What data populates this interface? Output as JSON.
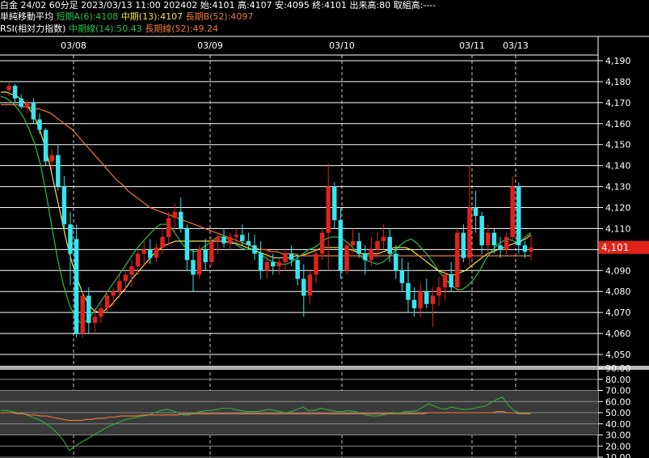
{
  "header": {
    "line1": "白金 24/02 60分足 2023/03/13 11:00 202402 始:4101 高:4107 安:4095 終:4101 出来高:80 取組高:----",
    "line2_title": "単純移動平均",
    "line2_short": "短期A(6):4108",
    "line2_mid": "中期(13):4107",
    "line2_long": "長期B(52):4097",
    "line3_title": "RSI(相対力指数)",
    "line3_mid": "中期線(14):50.43",
    "line3_long": "長期線(52):49.24"
  },
  "colors": {
    "up": "#e0221b",
    "down": "#36e6f2",
    "sma_short": "#26c24a",
    "sma_mid": "#f2e34a",
    "sma_long": "#f07a3a",
    "rsi_mid": "#2fae3a",
    "rsi_long": "#f07a3a",
    "price_tag": "#e0221b"
  },
  "chart_data": [
    {
      "type": "candlestick",
      "x_labels": [
        "03/08",
        "03/09",
        "03/10",
        "03/11",
        "03/13"
      ],
      "y_ticks": [
        "4,050",
        "4,060",
        "4,070",
        "4,080",
        "4,090",
        "4,100",
        "4,110",
        "4,120",
        "4,130",
        "4,140",
        "4,150",
        "4,160",
        "4,170",
        "4,180",
        "4,190"
      ],
      "ylim": [
        4045,
        4195
      ],
      "last_price_label": "4,101",
      "last_price": 4101,
      "series": [
        {
          "name": "短期A(6)",
          "values": [
            4173,
            4172,
            4170,
            4167,
            4163,
            4157,
            4150,
            4140,
            4126,
            4110,
            4095,
            4083,
            4074,
            4068,
            4065,
            4066,
            4069,
            4073,
            4077,
            4081,
            4085,
            4089,
            4093,
            4097,
            4101,
            4104,
            4107,
            4110,
            4112,
            4112,
            4110,
            4106,
            4102,
            4100,
            4099,
            4100,
            4102,
            4104,
            4106,
            4106,
            4105,
            4103,
            4101,
            4100,
            4100,
            4099,
            4097,
            4095,
            4094,
            4093,
            4093,
            4094,
            4096,
            4098,
            4100,
            4101,
            4103,
            4105,
            4106,
            4106,
            4105,
            4103,
            4100,
            4097,
            4095,
            4094,
            4093,
            4094,
            4096,
            4099,
            4102,
            4104,
            4105,
            4103,
            4100,
            4097,
            4093,
            4089,
            4086,
            4083,
            4081,
            4081,
            4083,
            4086,
            4090,
            4095,
            4099,
            4102,
            4104,
            4105,
            4104,
            4103,
            4106,
            4108
          ]
        },
        {
          "name": "中期(13)",
          "values": [
            4175,
            4175,
            4174,
            4173,
            4171,
            4168,
            4164,
            4158,
            4150,
            4140,
            4128,
            4116,
            4104,
            4094,
            4086,
            4079,
            4074,
            4071,
            4070,
            4071,
            4073,
            4076,
            4079,
            4082,
            4086,
            4089,
            4092,
            4095,
            4098,
            4100,
            4102,
            4103,
            4104,
            4104,
            4104,
            4104,
            4104,
            4104,
            4104,
            4104,
            4104,
            4104,
            4103,
            4103,
            4102,
            4101,
            4100,
            4099,
            4098,
            4097,
            4096,
            4096,
            4096,
            4096,
            4097,
            4097,
            4098,
            4099,
            4100,
            4101,
            4101,
            4101,
            4101,
            4100,
            4100,
            4099,
            4098,
            4098,
            4098,
            4098,
            4099,
            4100,
            4101,
            4101,
            4101,
            4100,
            4098,
            4096,
            4094,
            4092,
            4090,
            4089,
            4088,
            4088,
            4089,
            4090,
            4092,
            4094,
            4096,
            4098,
            4099,
            4100,
            4101,
            4102,
            4103,
            4104,
            4105,
            4107
          ]
        },
        {
          "name": "長期B(52)",
          "values": [
            4169,
            4169,
            4169,
            4169,
            4168,
            4168,
            4167,
            4167,
            4166,
            4165,
            4163,
            4161,
            4159,
            4157,
            4154,
            4151,
            4148,
            4145,
            4142,
            4139,
            4136,
            4133,
            4131,
            4128,
            4126,
            4124,
            4122,
            4120,
            4119,
            4118,
            4117,
            4116,
            4115,
            4114,
            4113,
            4112,
            4111,
            4110,
            4109,
            4108,
            4107,
            4106,
            4105,
            4104,
            4103,
            4102,
            4101,
            4100,
            4100,
            4099,
            4099,
            4098,
            4098,
            4098,
            4097,
            4097,
            4097,
            4097,
            4097,
            4097,
            4097,
            4097,
            4097,
            4097,
            4097,
            4097,
            4097,
            4097,
            4097,
            4097,
            4097,
            4097,
            4097,
            4097,
            4097,
            4097,
            4097,
            4097,
            4097,
            4097,
            4097,
            4097,
            4097,
            4097,
            4097,
            4097,
            4097,
            4097,
            4097,
            4097,
            4097,
            4097,
            4097,
            4097,
            4097,
            4097,
            4097
          ]
        }
      ],
      "candles": [
        [
          4176,
          4180,
          4173,
          4178
        ],
        [
          4178,
          4179,
          4170,
          4172
        ],
        [
          4172,
          4174,
          4167,
          4168
        ],
        [
          4168,
          4171,
          4165,
          4170
        ],
        [
          4170,
          4172,
          4160,
          4162
        ],
        [
          4162,
          4165,
          4155,
          4157
        ],
        [
          4157,
          4158,
          4140,
          4142
        ],
        [
          4142,
          4148,
          4138,
          4145
        ],
        [
          4145,
          4150,
          4128,
          4130
        ],
        [
          4130,
          4135,
          4110,
          4112
        ],
        [
          4112,
          4118,
          4083,
          4098
        ],
        [
          4105,
          4112,
          4058,
          4060
        ],
        [
          4060,
          4080,
          4058,
          4078
        ],
        [
          4078,
          4082,
          4060,
          4065
        ],
        [
          4065,
          4072,
          4060,
          4068
        ],
        [
          4068,
          4075,
          4065,
          4072
        ],
        [
          4072,
          4080,
          4070,
          4078
        ],
        [
          4078,
          4082,
          4073,
          4080
        ],
        [
          4080,
          4088,
          4077,
          4085
        ],
        [
          4085,
          4090,
          4080,
          4088
        ],
        [
          4088,
          4095,
          4082,
          4092
        ],
        [
          4092,
          4100,
          4088,
          4098
        ],
        [
          4098,
          4105,
          4092,
          4100
        ],
        [
          4100,
          4105,
          4093,
          4096
        ],
        [
          4096,
          4103,
          4094,
          4101
        ],
        [
          4101,
          4110,
          4098,
          4106
        ],
        [
          4106,
          4118,
          4102,
          4115
        ],
        [
          4115,
          4122,
          4108,
          4118
        ],
        [
          4118,
          4125,
          4108,
          4110
        ],
        [
          4110,
          4112,
          4090,
          4095
        ],
        [
          4095,
          4100,
          4080,
          4088
        ],
        [
          4088,
          4102,
          4086,
          4100
        ],
        [
          4100,
          4105,
          4090,
          4094
        ],
        [
          4094,
          4106,
          4092,
          4104
        ],
        [
          4104,
          4108,
          4098,
          4106
        ],
        [
          4106,
          4110,
          4101,
          4103
        ],
        [
          4103,
          4108,
          4100,
          4106
        ],
        [
          4106,
          4110,
          4103,
          4107
        ],
        [
          4107,
          4112,
          4102,
          4104
        ],
        [
          4104,
          4108,
          4100,
          4102
        ],
        [
          4102,
          4107,
          4095,
          4098
        ],
        [
          4098,
          4104,
          4086,
          4090
        ],
        [
          4090,
          4100,
          4086,
          4094
        ],
        [
          4094,
          4098,
          4088,
          4092
        ],
        [
          4092,
          4096,
          4088,
          4094
        ],
        [
          4094,
          4100,
          4090,
          4098
        ],
        [
          4098,
          4102,
          4092,
          4095
        ],
        [
          4095,
          4098,
          4083,
          4086
        ],
        [
          4086,
          4093,
          4068,
          4078
        ],
        [
          4078,
          4090,
          4074,
          4088
        ],
        [
          4088,
          4100,
          4084,
          4098
        ],
        [
          4098,
          4110,
          4095,
          4108
        ],
        [
          4108,
          4141,
          4090,
          4130
        ],
        [
          4130,
          4132,
          4110,
          4114
        ],
        [
          4114,
          4120,
          4086,
          4090
        ],
        [
          4090,
          4104,
          4088,
          4102
        ],
        [
          4102,
          4110,
          4098,
          4104
        ],
        [
          4104,
          4108,
          4096,
          4098
        ],
        [
          4098,
          4102,
          4088,
          4095
        ],
        [
          4095,
          4106,
          4092,
          4100
        ],
        [
          4100,
          4108,
          4096,
          4104
        ],
        [
          4104,
          4112,
          4100,
          4106
        ],
        [
          4106,
          4110,
          4094,
          4098
        ],
        [
          4098,
          4102,
          4086,
          4090
        ],
        [
          4090,
          4096,
          4080,
          4084
        ],
        [
          4084,
          4094,
          4070,
          4076
        ],
        [
          4076,
          4082,
          4068,
          4072
        ],
        [
          4072,
          4084,
          4068,
          4080
        ],
        [
          4080,
          4086,
          4072,
          4074
        ],
        [
          4074,
          4082,
          4063,
          4078
        ],
        [
          4078,
          4087,
          4073,
          4082
        ],
        [
          4082,
          4090,
          4076,
          4088
        ],
        [
          4088,
          4094,
          4080,
          4082
        ],
        [
          4082,
          4110,
          4080,
          4108
        ],
        [
          4108,
          4112,
          4094,
          4096
        ],
        [
          4096,
          4140,
          4092,
          4120
        ],
        [
          4120,
          4128,
          4108,
          4116
        ],
        [
          4116,
          4118,
          4098,
          4102
        ],
        [
          4102,
          4112,
          4098,
          4108
        ],
        [
          4108,
          4110,
          4098,
          4102
        ],
        [
          4102,
          4106,
          4096,
          4100
        ],
        [
          4100,
          4108,
          4098,
          4106
        ],
        [
          4106,
          4135,
          4104,
          4130
        ],
        [
          4130,
          4132,
          4098,
          4102
        ],
        [
          4102,
          4104,
          4096,
          4099
        ],
        [
          4099,
          4107,
          4095,
          4101
        ]
      ]
    },
    {
      "type": "line",
      "y_ticks": [
        "10.00",
        "20.00",
        "30.00",
        "40.00",
        "50.00",
        "60.00",
        "70.00",
        "80.00",
        "90.00"
      ],
      "ylim": [
        10,
        90
      ],
      "series": [
        {
          "name": "中期線(14)",
          "values": [
            52,
            52,
            51,
            50,
            49,
            47,
            45,
            43,
            40,
            36,
            31,
            25,
            16,
            20,
            23,
            26,
            29,
            32,
            35,
            38,
            40,
            42,
            44,
            45,
            46,
            47,
            48,
            50,
            52,
            53,
            52,
            50,
            48,
            48,
            50,
            51,
            52,
            52,
            53,
            54,
            54,
            53,
            52,
            51,
            51,
            51,
            52,
            53,
            52,
            51,
            50,
            51,
            53,
            55,
            52,
            52,
            54,
            53,
            52,
            51,
            51,
            52,
            51,
            50,
            48,
            47,
            47,
            48,
            49,
            50,
            50,
            51,
            51,
            52,
            55,
            58,
            56,
            54,
            53,
            55,
            54,
            53,
            53,
            54,
            55,
            56,
            59,
            62,
            64,
            57,
            52,
            50,
            49,
            50
          ]
        },
        {
          "name": "長期線(52)",
          "values": [
            50,
            50,
            50,
            49,
            49,
            48,
            48,
            47,
            47,
            46,
            45,
            44,
            43,
            43,
            43,
            44,
            44,
            45,
            45,
            46,
            46,
            47,
            47,
            47,
            47,
            48,
            48,
            48,
            48,
            48,
            48,
            48,
            49,
            49,
            49,
            49,
            49,
            49,
            49,
            49,
            49,
            49,
            49,
            49,
            49,
            49,
            49,
            49,
            49,
            49,
            49,
            49,
            49,
            49,
            49,
            49,
            49,
            49,
            49,
            49,
            49,
            49,
            49,
            49,
            49,
            49,
            49,
            49,
            49,
            49,
            49,
            49,
            49,
            49,
            49,
            50,
            50,
            50,
            50,
            50,
            50,
            50,
            50,
            50,
            50,
            50,
            50,
            51,
            51,
            50,
            50,
            49,
            49,
            49
          ]
        }
      ]
    }
  ]
}
